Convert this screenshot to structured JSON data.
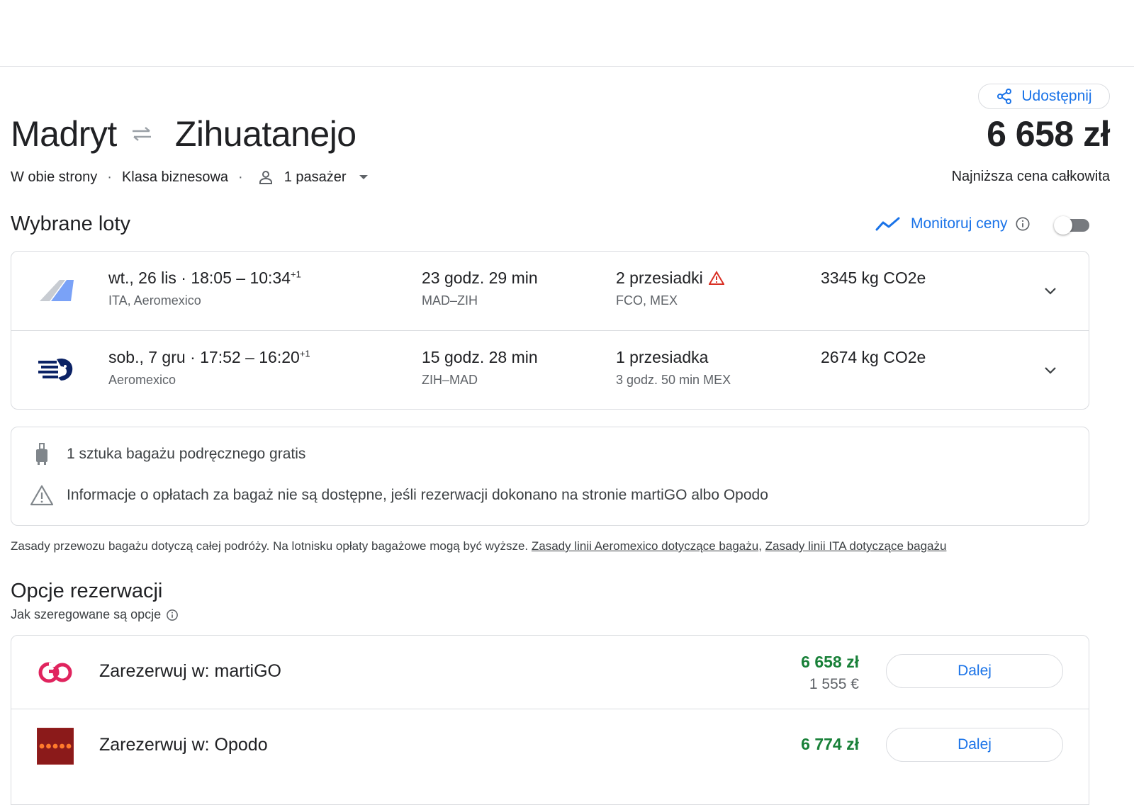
{
  "header": {
    "share_label": "Udostępnij",
    "origin": "Madryt",
    "destination": "Zihuatanejo",
    "price": "6 658 zł",
    "price_caption": "Najniższa cena całkowita"
  },
  "trip": {
    "type": "W obie strony",
    "cabin": "Klasa biznesowa",
    "passengers": "1 pasażer"
  },
  "selected": {
    "title": "Wybrane loty",
    "monitor_label": "Monitoruj ceny",
    "monitor_enabled": false,
    "flights": [
      {
        "date": "wt., 26 lis",
        "times": "18:05 – 10:34",
        "day_offset": "+1",
        "airlines": "ITA, Aeromexico",
        "duration": "23 godz. 29 min",
        "route": "MAD–ZIH",
        "stops": "2 przesiadki",
        "stops_detail": "FCO, MEX",
        "emissions": "3345 kg CO2e"
      },
      {
        "date": "sob., 7 gru",
        "times": "17:52 – 16:20",
        "day_offset": "+1",
        "airlines": "Aeromexico",
        "duration": "15 godz. 28 min",
        "route": "ZIH–MAD",
        "stops": "1 przesiadka",
        "stops_detail": "3 godz. 50 min MEX",
        "emissions": "2674 kg CO2e"
      }
    ]
  },
  "baggage": {
    "carry_on": "1 sztuka bagażu podręcznego gratis",
    "fee_warning": "Informacje o opłatach za bagaż nie są dostępne, jeśli rezerwacji dokonano na stronie martiGO albo Opodo",
    "policy_text": "Zasady przewozu bagażu dotyczą całej podróży. Na lotnisku opłaty bagażowe mogą być wyższe.",
    "link_aeromexico": "Zasady linii Aeromexico dotyczące bagażu",
    "link_separator": ",",
    "link_ita": "Zasady linii ITA dotyczące bagażu"
  },
  "booking": {
    "title": "Opcje rezerwacji",
    "sort_info": "Jak szeregowane są opcje",
    "options": [
      {
        "label": "Zarezerwuj w: martiGO",
        "price": "6 658 zł",
        "price_eur": "1 555 €",
        "button": "Dalej"
      },
      {
        "label": "Zarezerwuj w: Opodo",
        "price": "6 774 zł",
        "button": "Dalej"
      }
    ]
  },
  "colors": {
    "accent": "#1a73e8",
    "price_green": "#188038",
    "warning_red": "#d93025",
    "border": "#dadce0"
  }
}
